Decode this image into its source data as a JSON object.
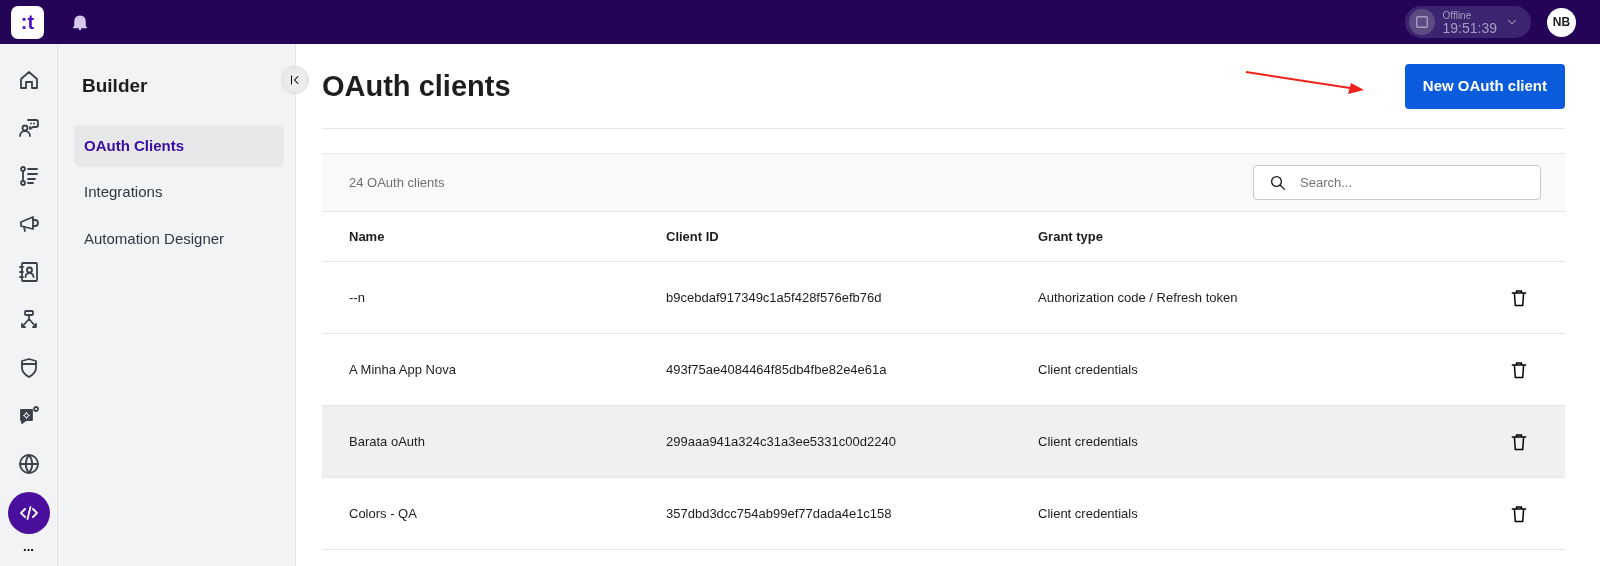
{
  "topbar": {
    "logo": ":t",
    "status": {
      "label": "Offline",
      "time": "19:51:39"
    },
    "avatar": "NB"
  },
  "rail": [
    {
      "selected": false
    },
    {
      "selected": false
    },
    {
      "selected": false
    },
    {
      "selected": false
    },
    {
      "selected": false
    },
    {
      "selected": false
    },
    {
      "selected": false
    },
    {
      "selected": false
    },
    {
      "selected": false
    },
    {
      "selected": true
    }
  ],
  "rail_more": "...",
  "sidebar": {
    "title": "Builder",
    "items": [
      {
        "label": "OAuth Clients",
        "selected": true
      },
      {
        "label": "Integrations",
        "selected": false
      },
      {
        "label": "Automation Designer",
        "selected": false
      }
    ]
  },
  "page": {
    "title": "OAuth clients",
    "primary_button": "New OAuth client"
  },
  "table": {
    "count": "24 OAuth clients",
    "search": {
      "placeholder": "Search..."
    },
    "columns": [
      "Name",
      "Client ID",
      "Grant type"
    ],
    "rows": [
      {
        "name": "--n",
        "client_id": "b9cebdaf917349c1a5f428f576efb76d",
        "grant_type": "Authorization code / Refresh token",
        "hovered": false
      },
      {
        "name": "A Minha App Nova",
        "client_id": "493f75ae4084464f85db4fbe82e4e61a",
        "grant_type": "Client credentials",
        "hovered": false
      },
      {
        "name": "Barata oAuth",
        "client_id": "299aaa941a324c31a3ee5331c00d2240",
        "grant_type": "Client credentials",
        "hovered": true
      },
      {
        "name": "Colors - QA",
        "client_id": "357dbd3dcc754ab99ef77dada4e1c158",
        "grant_type": "Client credentials",
        "hovered": false
      }
    ]
  }
}
